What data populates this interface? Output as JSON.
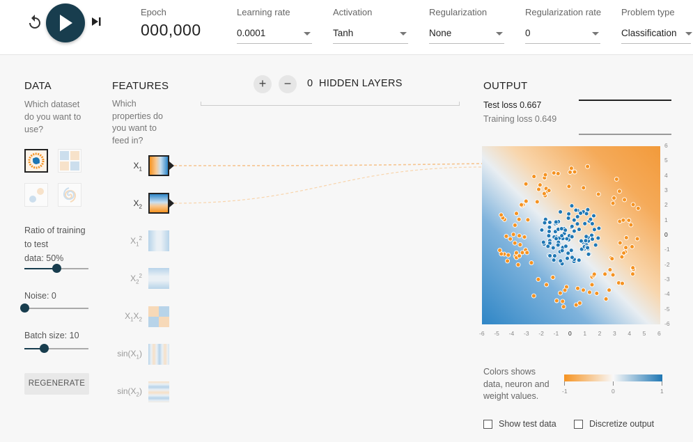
{
  "controls": {
    "epoch_label": "Epoch",
    "epoch_value": "000,000",
    "learning_rate": {
      "label": "Learning rate",
      "value": "0.0001"
    },
    "activation": {
      "label": "Activation",
      "value": "Tanh"
    },
    "regularization": {
      "label": "Regularization",
      "value": "None"
    },
    "regularization_rate": {
      "label": "Regularization rate",
      "value": "0"
    },
    "problem_type": {
      "label": "Problem type",
      "value": "Classification"
    }
  },
  "data_panel": {
    "title": "DATA",
    "description": [
      "Which dataset",
      "do you want to",
      "use?"
    ],
    "ratio_label": [
      "Ratio of training",
      "to test"
    ],
    "ratio_value_label": "data:  50%",
    "ratio_value": 0.5,
    "noise_label": "Noise:  0",
    "noise_value": 0,
    "batch_label": "Batch size:  10",
    "batch_value": 0.3,
    "regenerate_label": "REGENERATE",
    "datasets": [
      "circle",
      "xor",
      "gauss",
      "spiral"
    ],
    "selected_dataset": "circle"
  },
  "features_panel": {
    "title": "FEATURES",
    "description": [
      "Which",
      "properties do",
      "you want to",
      "feed in?"
    ],
    "features": [
      {
        "base": "X",
        "sub": "1",
        "sup": "",
        "active": true
      },
      {
        "base": "X",
        "sub": "2",
        "sup": "",
        "active": true
      },
      {
        "base": "X",
        "sub": "1",
        "sup": "2",
        "active": false
      },
      {
        "base": "X",
        "sub": "2",
        "sup": "2",
        "active": false
      },
      {
        "base": "X",
        "sub": "1",
        "mid": "X",
        "sub2": "2",
        "active": false
      },
      {
        "base": "sin(X",
        "sub": "1",
        "tail": ")",
        "active": false
      },
      {
        "base": "sin(X",
        "sub": "2",
        "tail": ")",
        "active": false
      }
    ]
  },
  "hidden_layers": {
    "count": "0",
    "label": "HIDDEN LAYERS",
    "add_symbol": "+",
    "remove_symbol": "−"
  },
  "output_panel": {
    "title": "OUTPUT",
    "test_loss": "Test loss 0.667",
    "training_loss": "Training loss 0.649",
    "x_ticks": [
      "-6",
      "-5",
      "-4",
      "-3",
      "-2",
      "-1",
      "0",
      "1",
      "2",
      "3",
      "4",
      "5",
      "6"
    ],
    "y_ticks": [
      "6",
      "5",
      "4",
      "3",
      "2",
      "1",
      "0",
      "-1",
      "-2",
      "-3",
      "-4",
      "-5",
      "-6"
    ],
    "legend_text": [
      "Colors shows",
      "data, neuron and",
      "weight values."
    ],
    "legend_ticks": [
      "-1",
      "0",
      "1"
    ],
    "show_test_data": "Show test data",
    "discretize_output": "Discretize output"
  },
  "colors": {
    "positive": "#1f77b4",
    "negative": "#f59322",
    "dark_teal": "#183d4e"
  }
}
